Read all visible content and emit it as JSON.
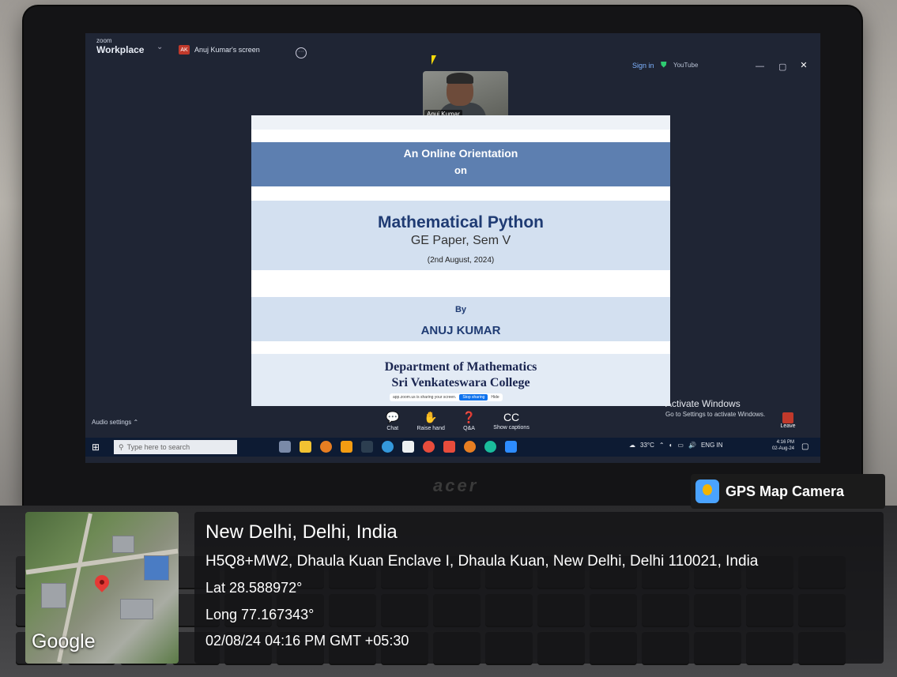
{
  "zoom": {
    "app_small": "zoom",
    "app_name": "Workplace",
    "share_badge": "AK",
    "share_tab": "Anuj Kumar's screen",
    "sign_in": "Sign in",
    "youtube": "YouTube",
    "participant_name": "Anuj Kumar",
    "audio_settings": "Audio settings",
    "controls": [
      {
        "icon": "chat-icon",
        "glyph": "💬",
        "label": "Chat"
      },
      {
        "icon": "raise-hand-icon",
        "glyph": "✋",
        "label": "Raise hand"
      },
      {
        "icon": "qa-icon",
        "glyph": "❓",
        "label": "Q&A"
      },
      {
        "icon": "captions-icon",
        "glyph": "CC",
        "label": "Show captions"
      }
    ],
    "leave": "Leave",
    "sharing_notice": "app.zoom.us is sharing your screen.",
    "stop_sharing": "Stop sharing",
    "hide": "Hide"
  },
  "slide": {
    "header_line1": "An Online Orientation",
    "header_line2": "on",
    "title": "Mathematical Python",
    "paper": "GE Paper, Sem V",
    "date": "(2nd August, 2024)",
    "by": "By",
    "author": "ANUJ KUMAR",
    "dept": "Department of Mathematics",
    "college": "Sri Venkateswara College"
  },
  "windows": {
    "activate_title": "Activate Windows",
    "activate_sub": "Go to Settings to activate Windows.",
    "search_placeholder": "Type here to search",
    "temperature": "33°C",
    "lang": "ENG IN",
    "time": "4:16 PM",
    "date": "02-Aug-24"
  },
  "laptop": {
    "brand": "acer"
  },
  "gps": {
    "brand": "GPS Map Camera",
    "map_label": "Google",
    "place": "New Delhi, Delhi, India",
    "address": "H5Q8+MW2, Dhaula Kuan Enclave I, Dhaula Kuan, New Delhi, Delhi 110021, India",
    "lat": "Lat 28.588972°",
    "long": "Long 77.167343°",
    "datetime": "02/08/24 04:16 PM GMT +05:30"
  }
}
